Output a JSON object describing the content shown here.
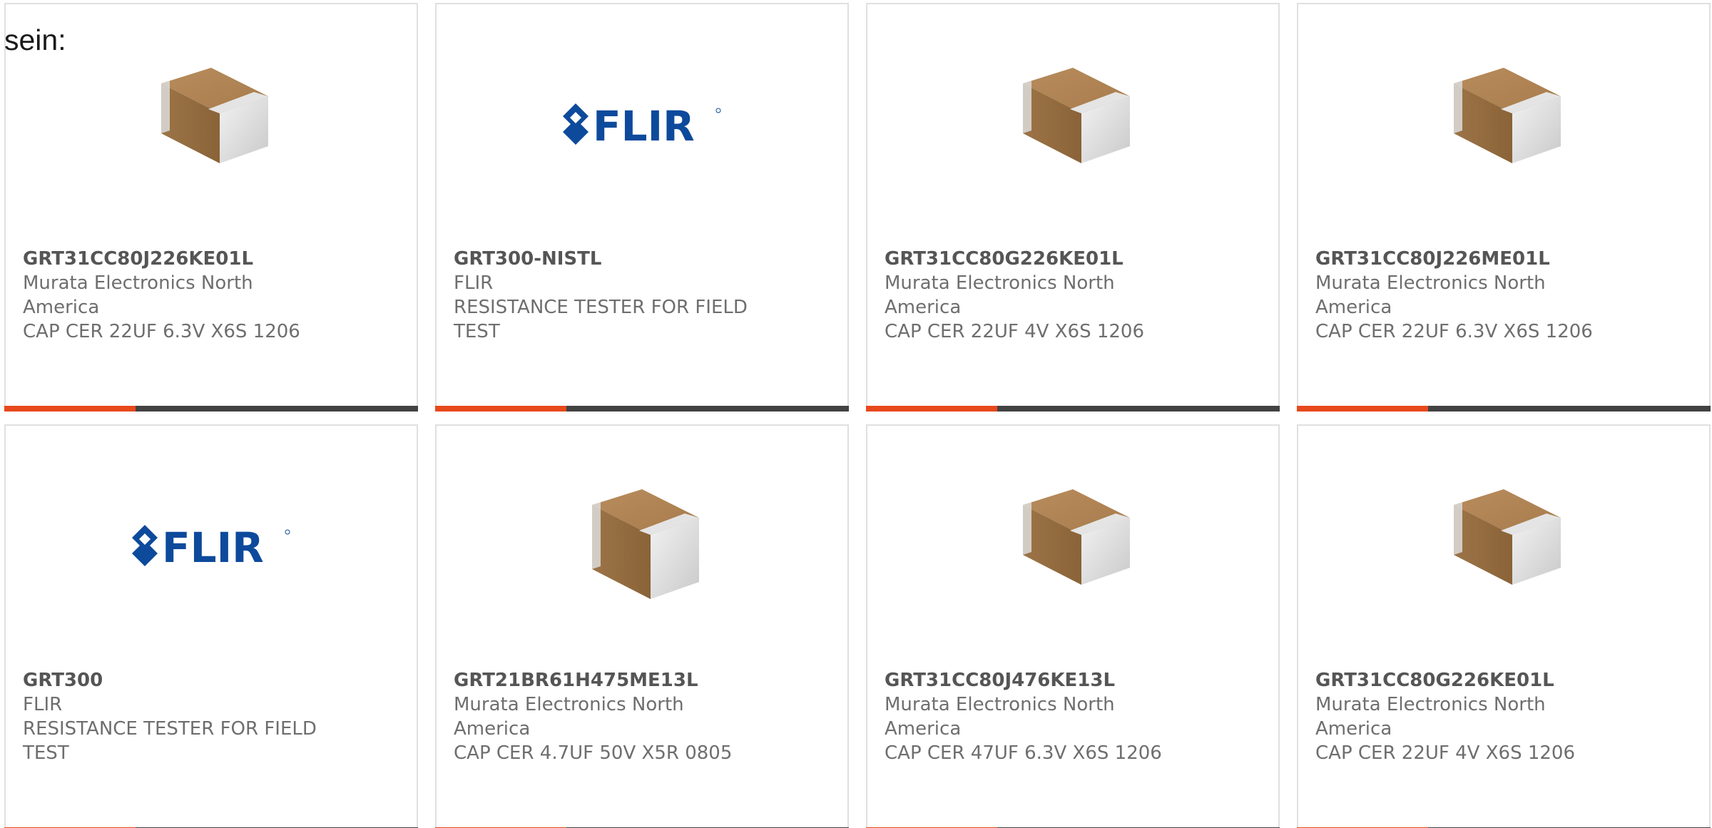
{
  "intro_text": "sein:",
  "colors": {
    "accent": "#e8481c",
    "bar": "#424242",
    "flir_blue": "#0d4a9c"
  },
  "products": [
    {
      "part_number": "GRT31CC80J226KE01L",
      "manufacturer": "Murata Electronics North America",
      "description": "CAP CER 22UF 6.3V X6S 1206",
      "image": "capacitor-1206"
    },
    {
      "part_number": "GRT300-NISTL",
      "manufacturer": "FLIR",
      "description": "RESISTANCE TESTER FOR FIELD TEST",
      "image": "flir-logo",
      "logo_text": "FLIR"
    },
    {
      "part_number": "GRT31CC80G226KE01L",
      "manufacturer": "Murata Electronics North America",
      "description": "CAP CER 22UF 4V X6S 1206",
      "image": "capacitor-1206"
    },
    {
      "part_number": "GRT31CC80J226ME01L",
      "manufacturer": "Murata Electronics North America",
      "description": "CAP CER 22UF 6.3V X6S 1206",
      "image": "capacitor-1206"
    },
    {
      "part_number": "GRT300",
      "manufacturer": "FLIR",
      "description": "RESISTANCE TESTER FOR FIELD TEST",
      "image": "flir-logo",
      "logo_text": "FLIR"
    },
    {
      "part_number": "GRT21BR61H475ME13L",
      "manufacturer": "Murata Electronics North America",
      "description": "CAP CER 4.7UF 50V X5R 0805",
      "image": "capacitor-0805"
    },
    {
      "part_number": "GRT31CC80J476KE13L",
      "manufacturer": "Murata Electronics North America",
      "description": "CAP CER 47UF 6.3V X6S 1206",
      "image": "capacitor-1206"
    },
    {
      "part_number": "GRT31CC80G226KE01L",
      "manufacturer": "Murata Electronics North America",
      "description": "CAP CER 22UF 4V X6S 1206",
      "image": "capacitor-1206"
    }
  ]
}
